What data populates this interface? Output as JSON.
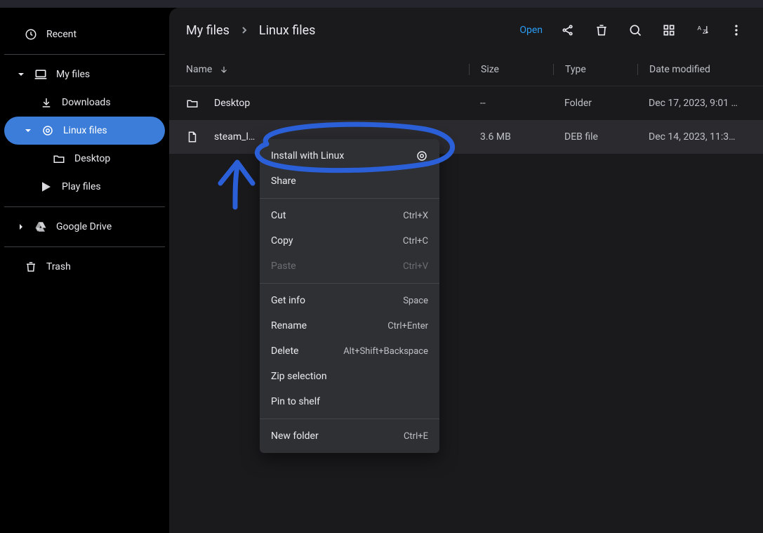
{
  "colors": {
    "accent": "#3b7dd8",
    "open": "#2a9df4",
    "annot": "#2a5fd8"
  },
  "sidebar": {
    "recent": {
      "label": "Recent"
    },
    "myfiles": {
      "label": "My files"
    },
    "downloads": {
      "label": "Downloads"
    },
    "linuxfiles": {
      "label": "Linux files"
    },
    "desktop": {
      "label": "Desktop"
    },
    "playfiles": {
      "label": "Play files"
    },
    "gdrive": {
      "label": "Google Drive"
    },
    "trash": {
      "label": "Trash"
    }
  },
  "breadcrumb": {
    "root": "My files",
    "current": "Linux files"
  },
  "toolbar": {
    "open": "Open"
  },
  "columns": {
    "name": "Name",
    "size": "Size",
    "type": "Type",
    "date": "Date modified"
  },
  "rows": [
    {
      "name": "Desktop",
      "size": "--",
      "type": "Folder",
      "date": "Dec 17, 2023, 9:01 …",
      "kind": "folder"
    },
    {
      "name": "steam_l…",
      "size": "3.6 MB",
      "type": "DEB file",
      "date": "Dec 14, 2023, 11:3…",
      "kind": "file"
    }
  ],
  "menu": {
    "install": "Install with Linux",
    "share": "Share",
    "cut": {
      "label": "Cut",
      "accel": "Ctrl+X"
    },
    "copy": {
      "label": "Copy",
      "accel": "Ctrl+C"
    },
    "paste": {
      "label": "Paste",
      "accel": "Ctrl+V"
    },
    "info": {
      "label": "Get info",
      "accel": "Space"
    },
    "rename": {
      "label": "Rename",
      "accel": "Ctrl+Enter"
    },
    "delete": {
      "label": "Delete",
      "accel": "Alt+Shift+Backspace"
    },
    "zip": "Zip selection",
    "pin": "Pin to shelf",
    "newfolder": {
      "label": "New folder",
      "accel": "Ctrl+E"
    }
  }
}
